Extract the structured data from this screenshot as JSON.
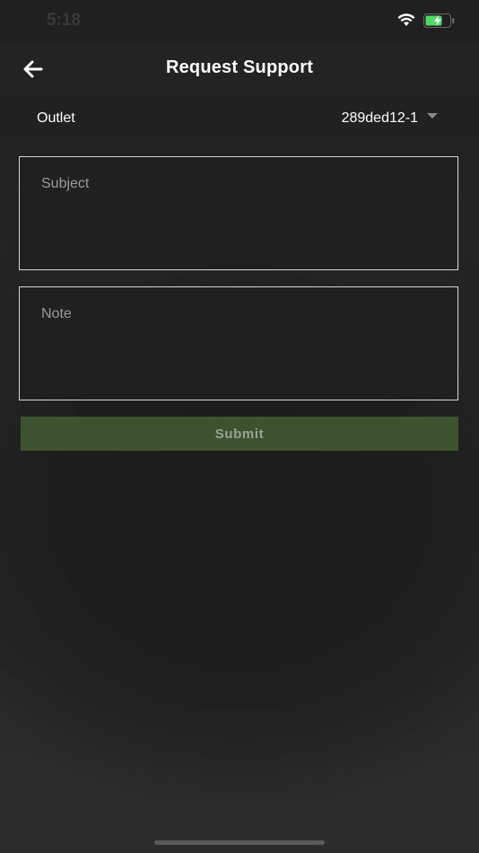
{
  "status_bar": {
    "time": "5:18",
    "icons": [
      "wifi-icon",
      "battery-charging-icon"
    ]
  },
  "header": {
    "title": "Request Support",
    "back_icon": "arrow-left-icon"
  },
  "outlet": {
    "label": "Outlet",
    "selected": "289ded12-1"
  },
  "form": {
    "subject_placeholder": "Subject",
    "note_placeholder": "Note",
    "submit_label": "Submit"
  },
  "colors": {
    "submit_bg": "#3d5330",
    "battery": "#4cd964"
  }
}
